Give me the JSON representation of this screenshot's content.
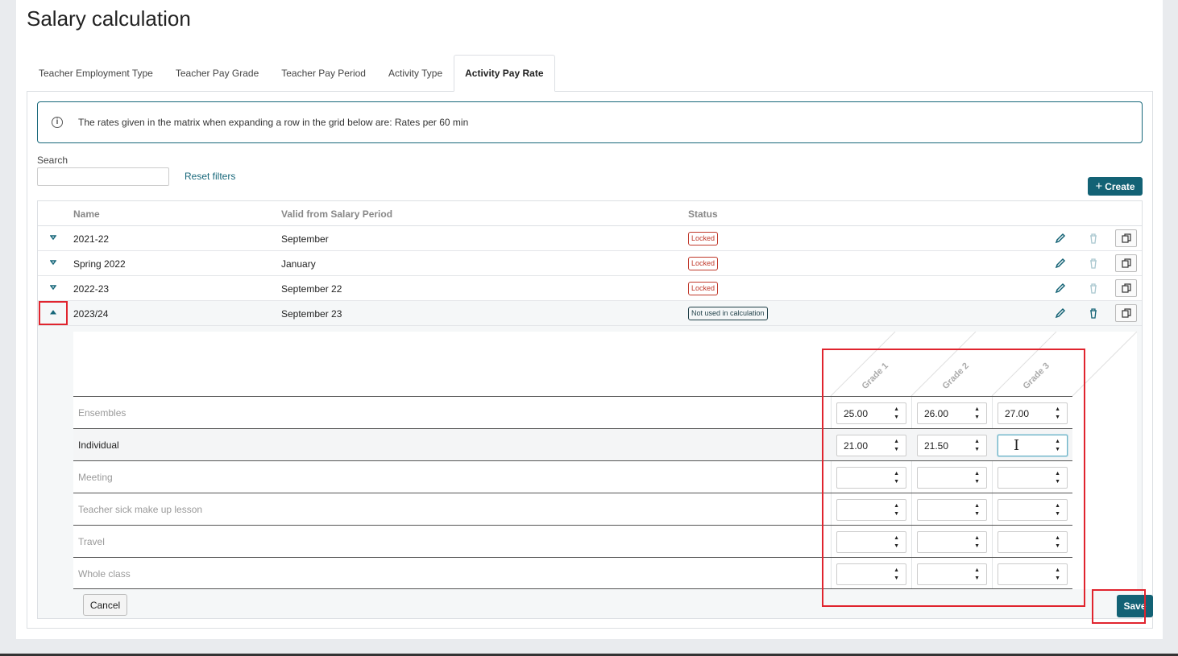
{
  "page": {
    "title": "Salary calculation"
  },
  "tabs": [
    {
      "label": "Teacher Employment Type",
      "active": false
    },
    {
      "label": "Teacher Pay Grade",
      "active": false
    },
    {
      "label": "Teacher Pay Period",
      "active": false
    },
    {
      "label": "Activity Type",
      "active": false
    },
    {
      "label": "Activity Pay Rate",
      "active": true
    }
  ],
  "info": {
    "text": "The rates given in the matrix when expanding a row in the grid below are: Rates per 60 min"
  },
  "filters": {
    "search_label": "Search",
    "search_value": "",
    "reset_label": "Reset filters"
  },
  "toolbar": {
    "create_label": "Create"
  },
  "grid": {
    "headers": {
      "name": "Name",
      "valid_from": "Valid from Salary Period",
      "status": "Status"
    },
    "rows": [
      {
        "name": "2021-22",
        "valid_from": "September",
        "status": "Locked",
        "expanded": false
      },
      {
        "name": "Spring 2022",
        "valid_from": "January",
        "status": "Locked",
        "expanded": false
      },
      {
        "name": "2022-23",
        "valid_from": "September 22",
        "status": "Locked",
        "expanded": false
      },
      {
        "name": "2023/24",
        "valid_from": "September 23",
        "status": "Not used in calculation",
        "expanded": true
      }
    ]
  },
  "matrix": {
    "grades": [
      "Grade 1",
      "Grade 2",
      "Grade 3"
    ],
    "activities": [
      {
        "label": "Ensembles",
        "values": [
          "25.00",
          "26.00",
          "27.00"
        ]
      },
      {
        "label": "Individual",
        "values": [
          "21.00",
          "21.50",
          ""
        ]
      },
      {
        "label": "Meeting",
        "values": [
          "",
          "",
          ""
        ]
      },
      {
        "label": "Teacher sick make up lesson",
        "values": [
          "",
          "",
          ""
        ]
      },
      {
        "label": "Travel",
        "values": [
          "",
          "",
          ""
        ]
      },
      {
        "label": "Whole class",
        "values": [
          "",
          "",
          ""
        ]
      }
    ]
  },
  "actions": {
    "cancel_label": "Cancel",
    "save_label": "Save"
  },
  "colors": {
    "accent": "#136275",
    "locked": "#c0392b",
    "highlight": "#e0242e"
  }
}
